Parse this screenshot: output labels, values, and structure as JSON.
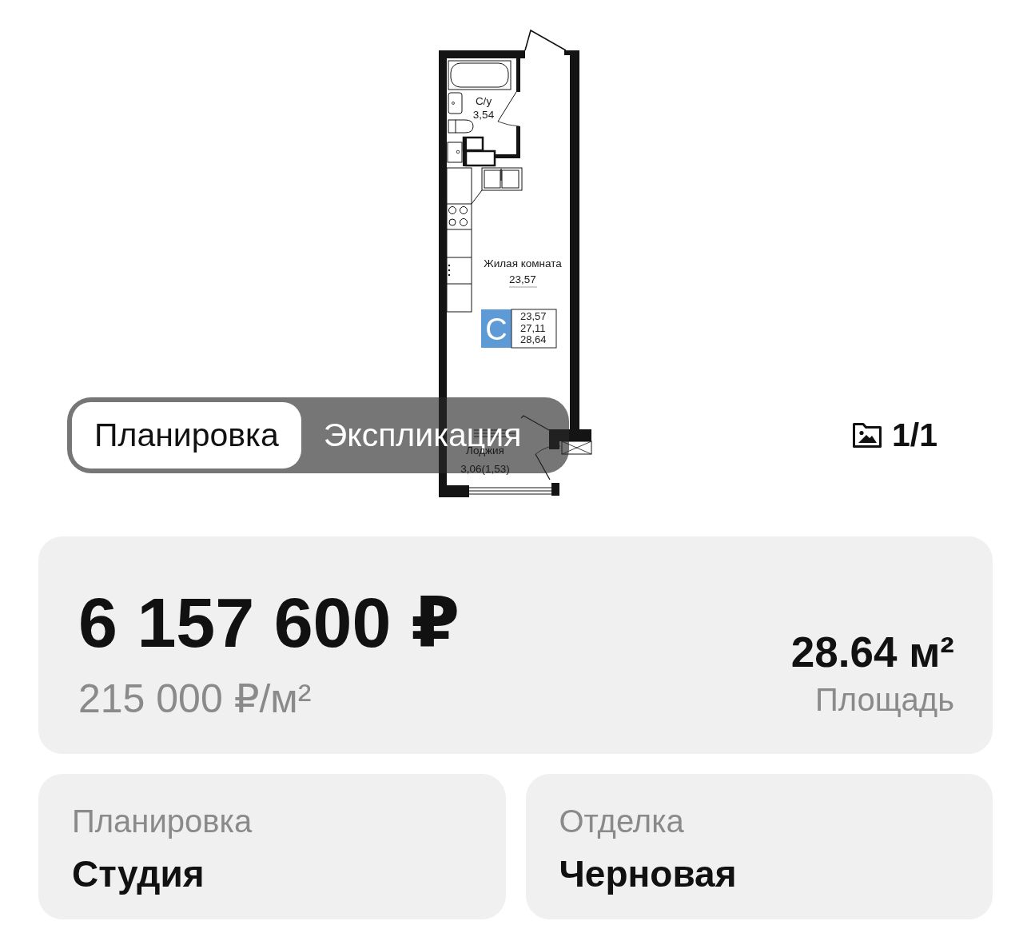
{
  "floor_plan": {
    "rooms": [
      {
        "name": "С/у",
        "area": "3,54"
      },
      {
        "name": "Жилая комната",
        "area": "23,57"
      },
      {
        "name": "Лоджия",
        "area": "3,06(1,53)"
      }
    ],
    "type_badge": {
      "letter": "С",
      "areas": [
        "23,57",
        "27,11",
        "28,64"
      ]
    }
  },
  "view_tabs": [
    {
      "label": "Планировка",
      "selected": true
    },
    {
      "label": "Экспликация",
      "selected": false
    }
  ],
  "gallery_counter": "1/1",
  "price_card": {
    "price": "6 157 600 ₽",
    "price_per_m2": "215 000 ₽/м²",
    "area": "28.64 м²",
    "area_label": "Площадь"
  },
  "details": [
    {
      "label": "Планировка",
      "value": "Студия"
    },
    {
      "label": "Отделка",
      "value": "Черновая"
    }
  ]
}
